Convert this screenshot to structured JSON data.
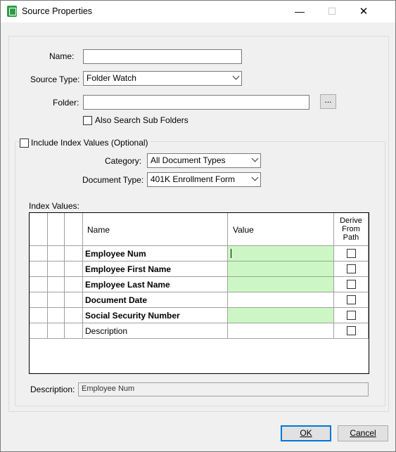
{
  "window": {
    "title": "Source Properties",
    "min": "—",
    "max": "☐",
    "close": "✕"
  },
  "form": {
    "name_label": "Name:",
    "name_value": "",
    "source_type_label": "Source Type:",
    "source_type_value": "Folder Watch",
    "folder_label": "Folder:",
    "folder_value": "",
    "browse_label": "...",
    "subfolders_label": "Also Search Sub Folders",
    "subfolders_checked": false
  },
  "index_group": {
    "include_label": "Include Index Values (Optional)",
    "include_checked": false,
    "category_label": "Category:",
    "category_value": "All Document Types",
    "doctype_label": "Document Type:",
    "doctype_value": "401K Enrollment Form",
    "index_values_label": "Index Values:"
  },
  "grid": {
    "headers": {
      "name": "Name",
      "value": "Value",
      "derive_1": "Derive",
      "derive_2": "From",
      "derive_3": "Path"
    },
    "rows": [
      {
        "name": "Employee Num",
        "value": "",
        "required": true,
        "derive": false
      },
      {
        "name": "Employee First Name",
        "value": "",
        "required": true,
        "derive": false
      },
      {
        "name": "Employee Last Name",
        "value": "",
        "required": true,
        "derive": false
      },
      {
        "name": "Document Date",
        "value": "",
        "required": false,
        "derive": false
      },
      {
        "name": "Social Security Number",
        "value": "",
        "required": true,
        "derive": false
      },
      {
        "name": "Description",
        "value": "",
        "required": false,
        "derive": false
      }
    ]
  },
  "description": {
    "label": "Description:",
    "value": "Employee Num"
  },
  "buttons": {
    "ok": "OK",
    "cancel": "Cancel"
  },
  "colors": {
    "required_value_bg": "#ccf7c4",
    "default_button_border": "#0078d7"
  }
}
